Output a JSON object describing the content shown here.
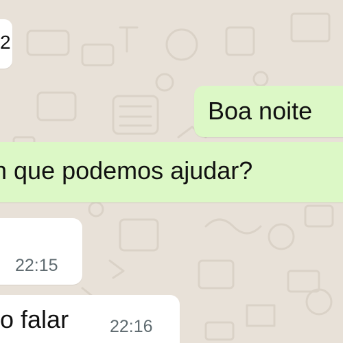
{
  "chat": {
    "messages": [
      {
        "direction": "incoming",
        "text": "2"
      },
      {
        "direction": "outgoing",
        "text": "Boa noite"
      },
      {
        "direction": "outgoing",
        "text": "n que podemos ajudar?"
      },
      {
        "direction": "incoming",
        "time": "22:15"
      },
      {
        "direction": "incoming",
        "text": "o falar",
        "time": "22:16"
      }
    ]
  },
  "colors": {
    "wallpaper": "#e8e1d8",
    "incoming_bubble": "#ffffff",
    "outgoing_bubble": "#dcf8c6",
    "timestamp": "#5f6b70"
  }
}
